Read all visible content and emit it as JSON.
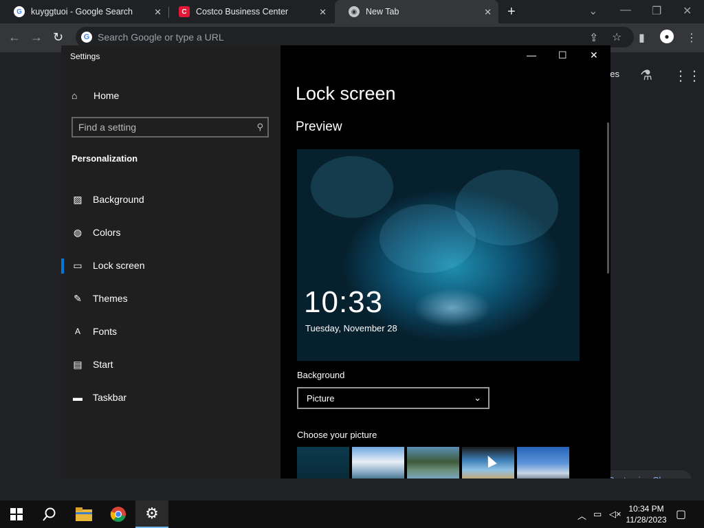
{
  "browser": {
    "tabs": [
      {
        "title": "kuyggtuoi - Google Search",
        "favicon": "google-g-icon"
      },
      {
        "title": "Costco Business Center",
        "favicon": "costco-icon"
      },
      {
        "title": "New Tab",
        "favicon": "chrome-icon",
        "active": true
      }
    ],
    "omnibox_placeholder": "Search Google or type a URL",
    "ntp_link_partial": "ges",
    "customize_label": "Customize Chrome"
  },
  "settings": {
    "window_title": "Settings",
    "home_label": "Home",
    "search_placeholder": "Find a setting",
    "section_title": "Personalization",
    "nav": [
      {
        "label": "Background",
        "icon": "picture-icon"
      },
      {
        "label": "Colors",
        "icon": "palette-icon"
      },
      {
        "label": "Lock screen",
        "icon": "lock-screen-icon",
        "selected": true
      },
      {
        "label": "Themes",
        "icon": "themes-icon"
      },
      {
        "label": "Fonts",
        "icon": "fonts-icon"
      },
      {
        "label": "Start",
        "icon": "start-icon"
      },
      {
        "label": "Taskbar",
        "icon": "taskbar-icon"
      }
    ],
    "page_title": "Lock screen",
    "preview_heading": "Preview",
    "preview_time": "10:33",
    "preview_date": "Tuesday, November 28",
    "background_label": "Background",
    "background_value": "Picture",
    "choose_label": "Choose your picture"
  },
  "taskbar": {
    "time": "10:34 PM",
    "date": "11/28/2023"
  },
  "colors": {
    "accent": "#0078d7"
  }
}
